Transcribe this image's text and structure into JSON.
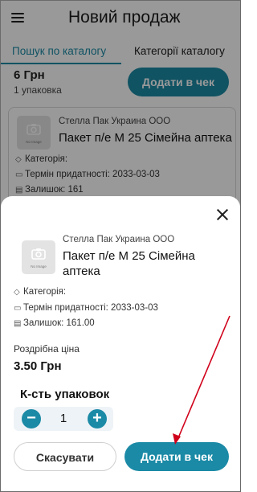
{
  "header": {
    "title": "Новий продаж"
  },
  "tabs": [
    {
      "label": "Пошук по каталогу"
    },
    {
      "label": "Категорії каталогу"
    }
  ],
  "previous_item": {
    "price": "6 Грн",
    "package": "1 упаковка",
    "add_label": "Додати в чек"
  },
  "product_card": {
    "supplier": "Стелла Пак Украина ООО",
    "name": "Пакет п/е М 25 Сімейна аптека",
    "category": "Категорія:",
    "expiry": "Термін придатності: 2033-03-03",
    "stock": "Залишок: 161",
    "image_caption": "No Image"
  },
  "sheet": {
    "supplier": "Стелла Пак Украина ООО",
    "name_line1": "Пакет п/е М 25 Сімейна",
    "name_line2": "аптека",
    "image_caption": "No Image",
    "category": "Категорія:",
    "expiry": "Термін придатності: 2033-03-03",
    "stock": "Залишок: 161.00",
    "price_label": "Роздрібна ціна",
    "price": "3.50 Грн",
    "qty_label": "К-сть упаковок",
    "qty": "1",
    "minus": "−",
    "plus": "+",
    "cancel_label": "Скасувати",
    "add_label": "Додати в чек"
  },
  "icons": {
    "menu": "menu-icon",
    "close": "close-icon",
    "category": "tag-icon",
    "expiry": "calendar-icon",
    "stock": "archive-icon",
    "image": "camera-icon"
  },
  "colors": {
    "accent": "#1b8aa6",
    "annotation_arrow": "#d0021b"
  }
}
